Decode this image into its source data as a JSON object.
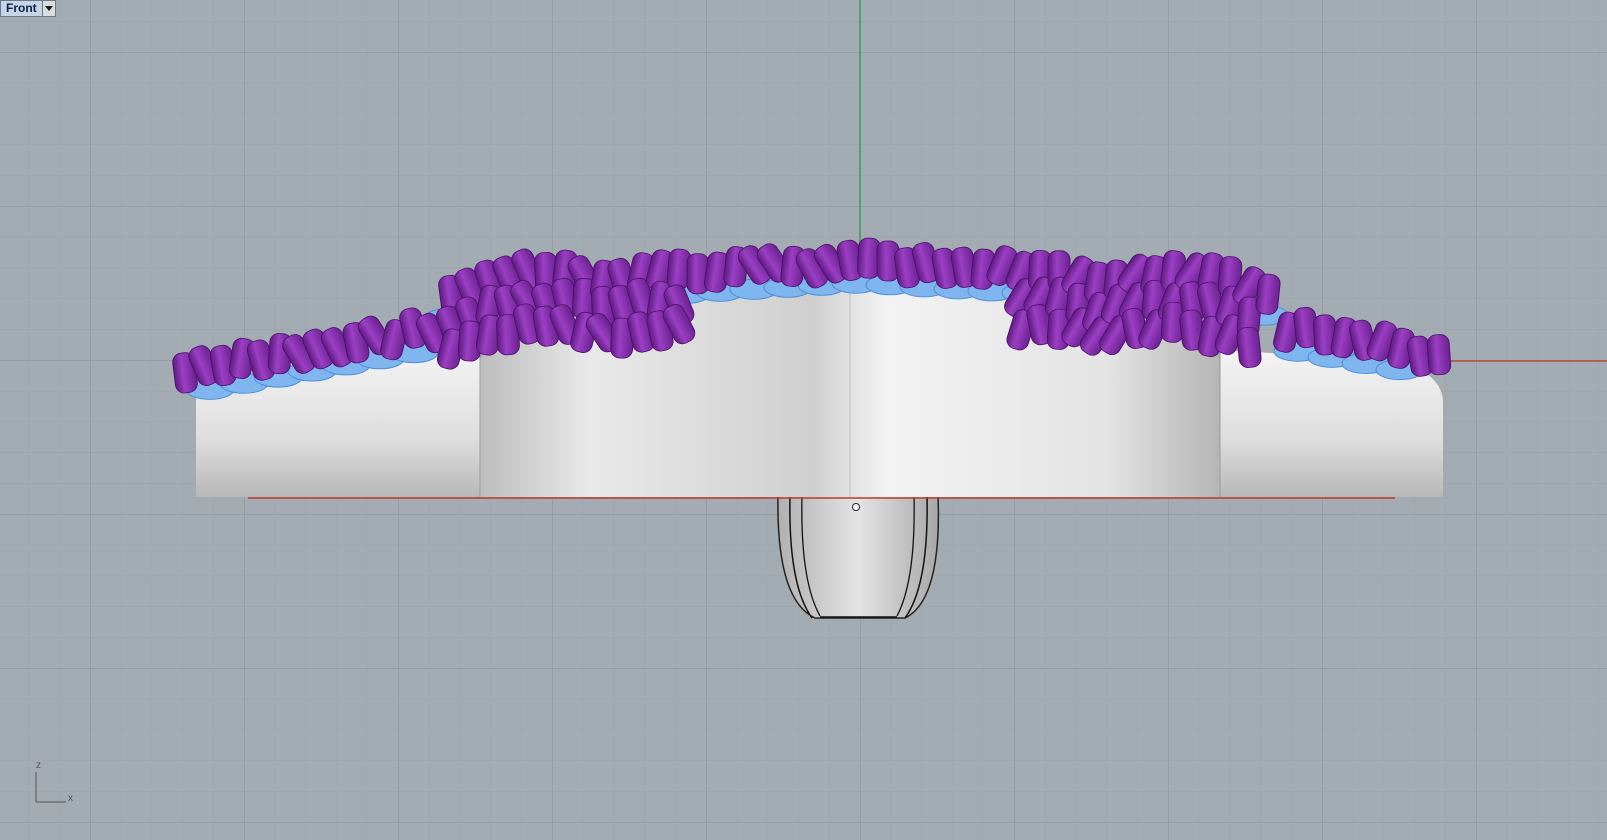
{
  "viewport": {
    "title": "Front",
    "menu_icon": "chevron-down-icon",
    "axis_labels": {
      "vertical": "z",
      "horizontal": "x"
    }
  },
  "colors": {
    "background": "#a3abb3",
    "grid_minor": "#9aa2ab",
    "grid_major": "#8e969f",
    "x_axis": "#c0392b",
    "z_axis": "#2e9e45",
    "metal": "#e8e8e8",
    "prong": "#8a2fb0",
    "gem": "#7fb6f0"
  }
}
